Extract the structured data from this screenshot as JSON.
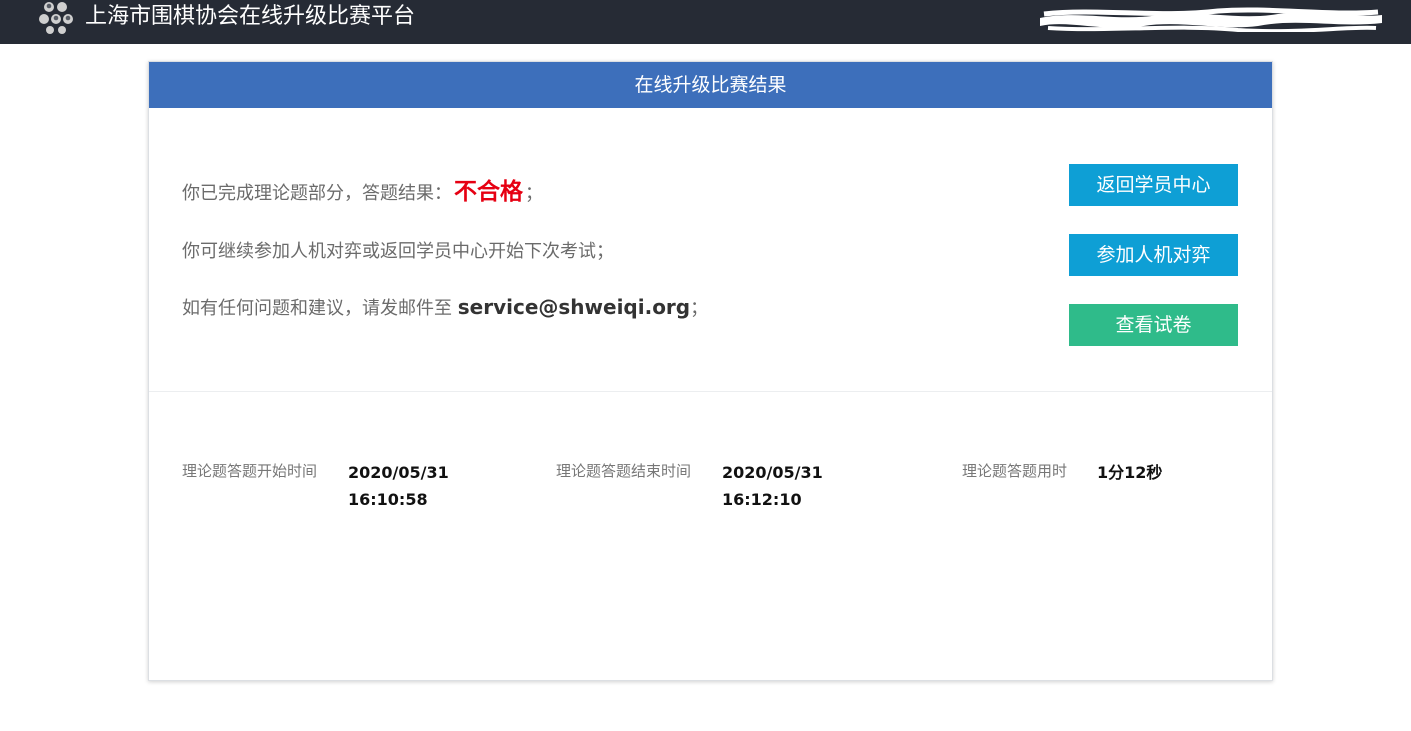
{
  "header": {
    "site_title": "上海市围棋协会在线升级比赛平台",
    "logo_icon": "go-stones-logo-icon",
    "user_name_redacted": true
  },
  "panel": {
    "title": "在线升级比赛结果"
  },
  "result": {
    "line1_prefix": "你已完成理论题部分，答题结果：",
    "status": "不合格",
    "line1_suffix": "；",
    "line2": "你可继续参加人机对弈或返回学员中心开始下次考试；",
    "line3_prefix": "如有任何问题和建议，请发邮件至 ",
    "email": "service@shweiqi.org",
    "line3_suffix": "；"
  },
  "actions": {
    "back_label": "返回学员中心",
    "play_ai_label": "参加人机对弈",
    "view_paper_label": "查看试卷"
  },
  "stats": {
    "start_label": "理论题答题开始时间",
    "start_date": "2020/05/31",
    "start_time": "16:10:58",
    "end_label": "理论题答题结束时间",
    "end_date": "2020/05/31",
    "end_time": "16:12:10",
    "duration_label": "理论题答题用时",
    "duration": "1分12秒"
  },
  "colors": {
    "topbar": "#262b35",
    "panel_header": "#3d6fbb",
    "button_blue": "#0e9fd5",
    "button_green": "#2fbb8a",
    "fail_red": "#e60012"
  }
}
